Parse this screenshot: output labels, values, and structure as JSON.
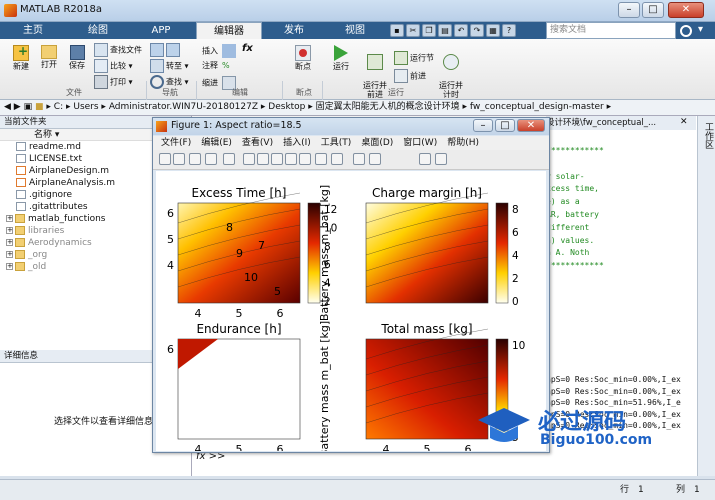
{
  "app": {
    "title": "MATLAB R2018a"
  },
  "tabs": [
    "主页",
    "绘图",
    "APP",
    "编辑器",
    "发布",
    "视图"
  ],
  "active_tab": "编辑器",
  "search": {
    "placeholder": "搜索文档"
  },
  "ribbon": {
    "new": "新建",
    "open": "打开",
    "save": "保存",
    "find_file": "查找文件",
    "compare": "比较",
    "print": "打印",
    "insert": "插入",
    "fx": "fx",
    "comment": "注释",
    "indent": "缩进",
    "goto": "转至",
    "find": "查找",
    "breakpoint": "断点",
    "run": "运行",
    "run_advance": "运行并\n前进",
    "run_section": "运行节",
    "advance": "前进",
    "run_time": "运行并\n计时",
    "sections": {
      "file": "文件",
      "nav": "导航",
      "edit": "编辑",
      "breakpoints": "断点",
      "run": "运行"
    }
  },
  "address": {
    "parts": [
      "C:",
      "Users",
      "Administrator.WIN7U-20180127Z",
      "Desktop",
      "固定翼太阳能无人机的概念设计环境",
      "fw_conceptual_design-master"
    ]
  },
  "current_folder": {
    "header": "当前文件夹",
    "column": "名称",
    "items": [
      {
        "name": "readme.md",
        "type": "file"
      },
      {
        "name": "LICENSE.txt",
        "type": "file"
      },
      {
        "name": "AirplaneDesign.m",
        "type": "mfile"
      },
      {
        "name": "AirplaneAnalysis.m",
        "type": "mfile"
      },
      {
        "name": ".gitignore",
        "type": "file"
      },
      {
        "name": ".gitattributes",
        "type": "file"
      },
      {
        "name": "matlab_functions",
        "type": "folder"
      },
      {
        "name": "libraries",
        "type": "folder"
      },
      {
        "name": "Aerodynamics",
        "type": "folder"
      },
      {
        "name": "_org",
        "type": "folder"
      },
      {
        "name": "_old",
        "type": "folder"
      }
    ]
  },
  "details": {
    "header": "详细信息",
    "placeholder": "选择文件以查看详细信息"
  },
  "editor_tab": "设计环境\\fw_conceptual_...",
  "workspace_label": "工作区",
  "editor_lines": [
    "************",
    "",
    "r solar-",
    "xcess time,",
    "e) as a",
    "AR, battery",
    "different",
    "n) values.",
    "n A. Noth",
    "************"
  ],
  "cmd_lines": [
    "apS=0    Res:Soc_min=0.00%,I_ex",
    "apS=0    Res:Soc_min=0.00%,I_ex",
    "apS=0    Res:Soc_min=51.96%,I_e",
    "apS=0    Res:Soc_min=0.00%,I_ex",
    "apS=0    Res:Soc_min=0.00%,I_ex"
  ],
  "prompt": "fx >>",
  "status": {
    "row_label": "行",
    "row": "1",
    "col_label": "列",
    "col": "1"
  },
  "figure": {
    "title": "Figure 1: Aspect ratio=18.5",
    "menu": [
      "文件(F)",
      "编辑(E)",
      "查看(V)",
      "插入(I)",
      "工具(T)",
      "桌面(D)",
      "窗口(W)",
      "帮助(H)"
    ],
    "subplots": [
      {
        "title": "Excess Time [h]",
        "ylabel": "Battery mass m_bat [kg]",
        "yticks": [
          "6",
          "5",
          "4"
        ],
        "cbar": [
          "12",
          "10",
          "8",
          "6",
          "4",
          "2"
        ],
        "contours": [
          "8",
          "9",
          "10",
          "7",
          "5"
        ],
        "xticks": [
          "4",
          "5",
          "6"
        ]
      },
      {
        "title": "Charge margin [h]",
        "ylabel": "",
        "yticks": [],
        "cbar": [
          "8",
          "6",
          "4",
          "2",
          "0"
        ],
        "contours": [],
        "xticks": []
      },
      {
        "title": "Endurance [h]",
        "ylabel": "Battery mass m_bat [kg]",
        "yticks": [
          "6"
        ],
        "cbar": [],
        "contours": [],
        "xticks": [
          "4",
          "5",
          "6"
        ]
      },
      {
        "title": "Total mass [kg]",
        "ylabel": "",
        "yticks": [],
        "cbar": [
          "10",
          "5"
        ],
        "contours": [],
        "xticks": [
          "4",
          "5",
          "6"
        ]
      }
    ]
  },
  "watermark": {
    "text": "必过源码",
    "url": "Biguo100.com"
  }
}
